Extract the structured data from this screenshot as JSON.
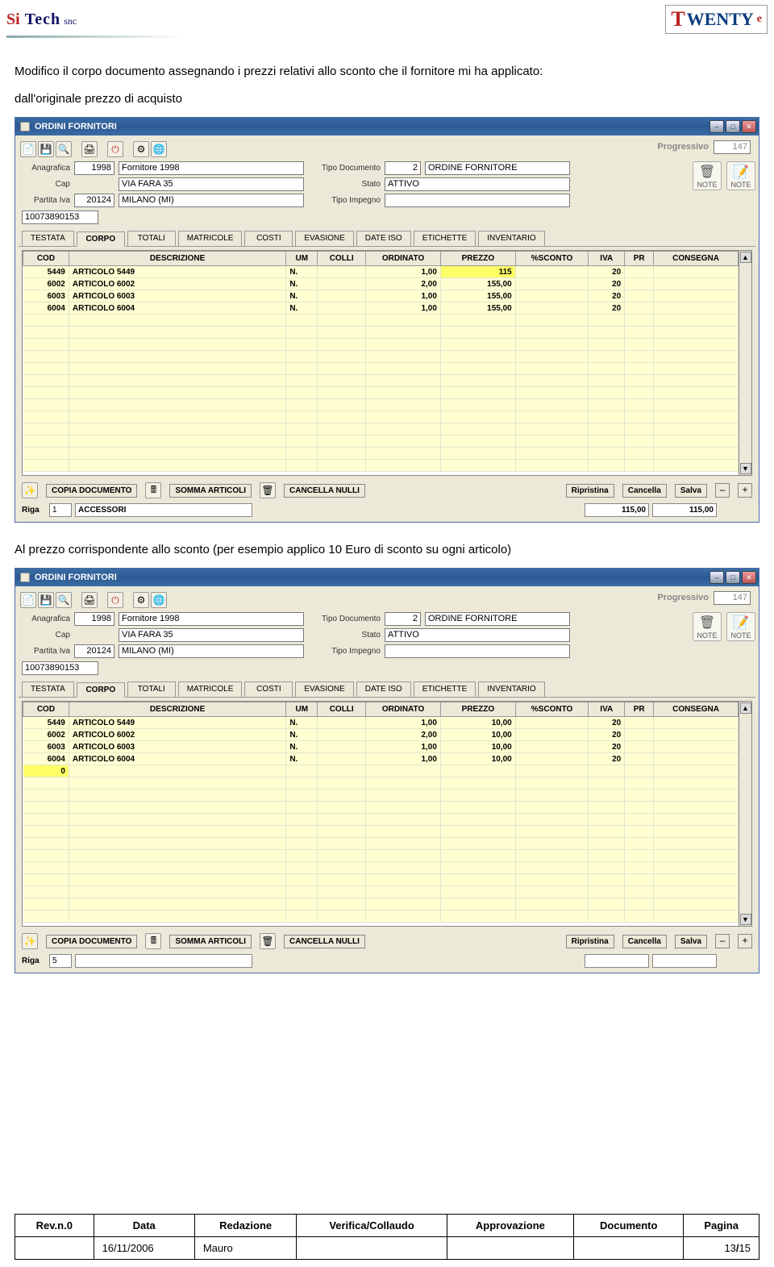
{
  "header": {
    "logo_si": "Si",
    "logo_tech": "Tech",
    "logo_snc": "snc",
    "logo_twenty_t": "T",
    "logo_twenty_rest": "WENTY",
    "logo_twenty_e": "e"
  },
  "para1": "Modifico il corpo documento assegnando i prezzi relativi allo sconto che il fornitore mi ha applicato:",
  "para1b": "dall'originale prezzo di acquisto",
  "para2": "Al prezzo corrispondente allo sconto (per esempio applico 10 Euro di sconto su ogni articolo)",
  "win": {
    "title": "ORDINI FORNITORI",
    "progressivo_label": "Progressivo",
    "progressivo_val": "147",
    "labels": {
      "anagrafica": "Anagrafica",
      "cap": "Cap",
      "piva": "Partita Iva",
      "tipo_doc": "Tipo Documento",
      "stato": "Stato",
      "tipo_imp": "Tipo Impegno"
    },
    "anagrafica_code": "1998",
    "anagrafica_name": "Fornitore 1998",
    "via": "VIA FARA 35",
    "cap_val": "20124",
    "citta": "MILANO (MI)",
    "piva_val": "10073890153",
    "tipo_doc_code": "2",
    "tipo_doc_name": "ORDINE FORNITORE",
    "stato_val": "ATTIVO",
    "note_lbl": "NOTE",
    "tabs": [
      "TESTATA",
      "CORPO",
      "TOTALI",
      "MATRICOLE",
      "COSTI",
      "EVASIONE",
      "DATE ISO",
      "ETICHETTE",
      "INVENTARIO"
    ],
    "tab_active": 1,
    "grid_headers": [
      "COD",
      "DESCRIZIONE",
      "UM",
      "COLLI",
      "ORDINATO",
      "PREZZO",
      "%SCONTO",
      "IVA",
      "PR",
      "CONSEGNA"
    ],
    "bottom": {
      "copia": "COPIA DOCUMENTO",
      "somma": "SOMMA ARTICOLI",
      "cancella_nulli": "CANCELLA NULLI",
      "ripristina": "Ripristina",
      "cancella": "Cancella",
      "salva": "Salva",
      "minus": "–",
      "plus": "+"
    },
    "riga_label": "Riga"
  },
  "grid1": {
    "rows": [
      {
        "cod": "5449",
        "desc": "ARTICOLO 5449",
        "um": "N.",
        "colli": "",
        "ord": "1,00",
        "prezzo": "115",
        "sconto": "",
        "iva": "20",
        "pr": "",
        "cons": "",
        "hl_prezzo": true
      },
      {
        "cod": "6002",
        "desc": "ARTICOLO 6002",
        "um": "N.",
        "colli": "",
        "ord": "2,00",
        "prezzo": "155,00",
        "sconto": "",
        "iva": "20",
        "pr": "",
        "cons": ""
      },
      {
        "cod": "6003",
        "desc": "ARTICOLO 6003",
        "um": "N.",
        "colli": "",
        "ord": "1,00",
        "prezzo": "155,00",
        "sconto": "",
        "iva": "20",
        "pr": "",
        "cons": ""
      },
      {
        "cod": "6004",
        "desc": "ARTICOLO 6004",
        "um": "N.",
        "colli": "",
        "ord": "1,00",
        "prezzo": "155,00",
        "sconto": "",
        "iva": "20",
        "pr": "",
        "cons": ""
      }
    ],
    "riga_val": "1",
    "riga_desc": "ACCESSORI",
    "tot1": "115,00",
    "tot2": "115,00"
  },
  "grid2": {
    "rows": [
      {
        "cod": "5449",
        "desc": "ARTICOLO 5449",
        "um": "N.",
        "colli": "",
        "ord": "1,00",
        "prezzo": "10,00",
        "sconto": "",
        "iva": "20",
        "pr": "",
        "cons": ""
      },
      {
        "cod": "6002",
        "desc": "ARTICOLO 6002",
        "um": "N.",
        "colli": "",
        "ord": "2,00",
        "prezzo": "10,00",
        "sconto": "",
        "iva": "20",
        "pr": "",
        "cons": ""
      },
      {
        "cod": "6003",
        "desc": "ARTICOLO 6003",
        "um": "N.",
        "colli": "",
        "ord": "1,00",
        "prezzo": "10,00",
        "sconto": "",
        "iva": "20",
        "pr": "",
        "cons": ""
      },
      {
        "cod": "6004",
        "desc": "ARTICOLO 6004",
        "um": "N.",
        "colli": "",
        "ord": "1,00",
        "prezzo": "10,00",
        "sconto": "",
        "iva": "20",
        "pr": "",
        "cons": ""
      },
      {
        "cod": "0",
        "desc": "",
        "um": "",
        "colli": "",
        "ord": "",
        "prezzo": "",
        "sconto": "",
        "iva": "",
        "pr": "",
        "cons": "",
        "hl_cod": true
      }
    ],
    "riga_val": "5",
    "riga_desc": "",
    "tot1": "",
    "tot2": ""
  },
  "footer": {
    "headers": [
      "Rev.n.0",
      "Data",
      "Redazione",
      "Verifica/Collaudo",
      "Approvazione",
      "Documento",
      "Pagina"
    ],
    "data": "16/11/2006",
    "redazione": "Mauro",
    "verifica": "",
    "approv": "",
    "doc": "",
    "page_cur": "13",
    "page_sep": "/",
    "page_tot": "15"
  }
}
